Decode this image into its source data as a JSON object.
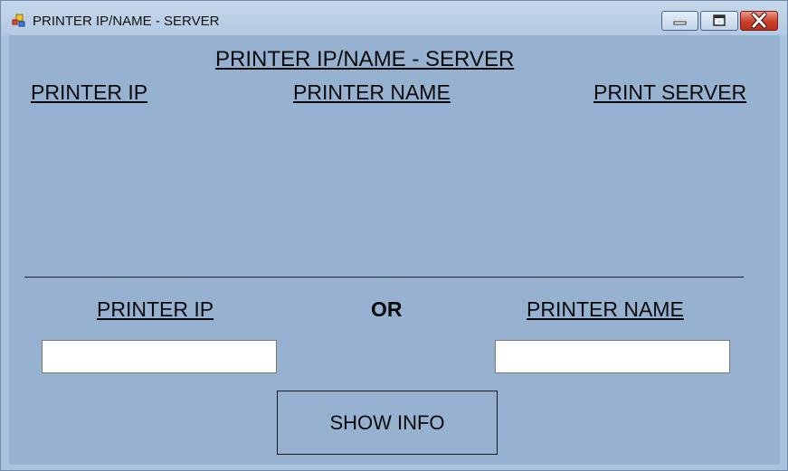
{
  "window": {
    "title": "PRINTER IP/NAME - SERVER",
    "icon": "app-window-icon",
    "controls": {
      "minimize": "minimize-icon",
      "maximize": "maximize-icon",
      "close": "close-icon"
    }
  },
  "header": {
    "title": "PRINTER IP/NAME - SERVER",
    "columns": {
      "ip": "PRINTER IP",
      "name": "PRINTER NAME",
      "server": "PRINT SERVER"
    }
  },
  "search": {
    "ip_label": "PRINTER IP",
    "or_label": "OR",
    "name_label": "PRINTER NAME",
    "ip_value": "",
    "name_value": ""
  },
  "actions": {
    "show_info": "SHOW INFO"
  },
  "colors": {
    "client_background": "#97b2d1",
    "close_button": "#c8402b",
    "frame": "#a9c3df"
  }
}
